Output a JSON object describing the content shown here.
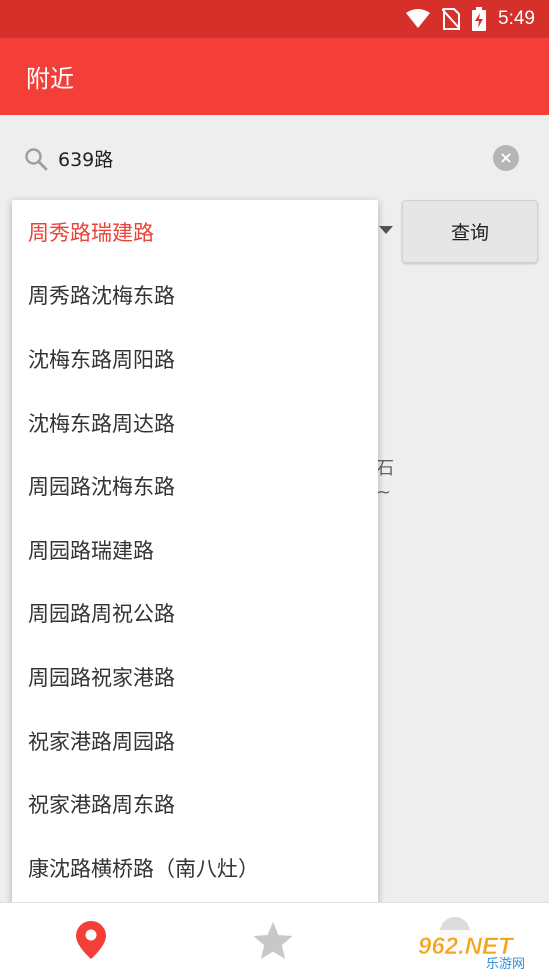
{
  "status_bar": {
    "time": "5:49",
    "icons": [
      "wifi-icon",
      "no-sim-icon",
      "battery-charging-icon"
    ]
  },
  "app_bar": {
    "title": "附近"
  },
  "search": {
    "value": "639路",
    "icon": "search-icon",
    "clear_icon": "clear-icon"
  },
  "query_button": {
    "label": "查询"
  },
  "background_fragments": [
    "石",
    "~"
  ],
  "dropdown": {
    "selected_index": 0,
    "items": [
      "周秀路瑞建路",
      "周秀路沈梅东路",
      "沈梅东路周阳路",
      "沈梅东路周达路",
      "周园路沈梅东路",
      "周园路瑞建路",
      "周园路周祝公路",
      "周园路祝家港路",
      "祝家港路周园路",
      "祝家港路周东路",
      "康沈路横桥路（南八灶）"
    ]
  },
  "bottom_nav": {
    "items": [
      {
        "icon": "location-pin-icon",
        "active": true
      },
      {
        "icon": "star-icon",
        "active": false
      },
      {
        "icon": "third-tab-icon",
        "active": false
      }
    ]
  },
  "watermark": {
    "text": "962.NET",
    "subtext": "乐游网"
  },
  "colors": {
    "status_bar": "#d6302a",
    "app_bar": "#f33f38",
    "accent": "#e8443a",
    "background": "#eeeeee"
  }
}
